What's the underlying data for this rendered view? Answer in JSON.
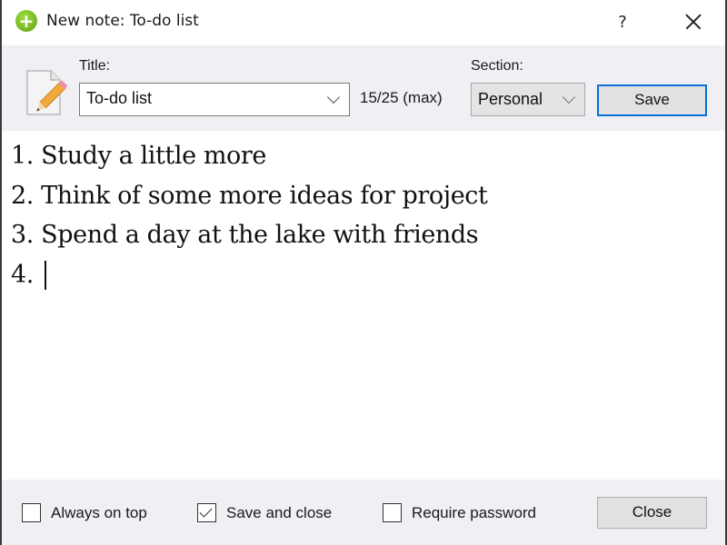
{
  "window": {
    "title": "New note: To-do list",
    "app_icon": "plus-circle-icon",
    "help_label": "?",
    "close_icon": "close-icon"
  },
  "header": {
    "note_icon": "note-pencil-icon",
    "title_label": "Title:",
    "title_value": "To-do list",
    "char_count": "15/25 (max)",
    "section_label": "Section:",
    "section_value": "Personal",
    "save_label": "Save"
  },
  "editor": {
    "lines": [
      "1. Study a little more",
      "2. Think of some more ideas for project",
      "3. Spend a day at the lake with friends",
      "4. "
    ]
  },
  "footer": {
    "always_on_top": {
      "label": "Always on top",
      "checked": false
    },
    "save_and_close": {
      "label": "Save and close",
      "checked": true
    },
    "require_password": {
      "label": "Require password",
      "checked": false
    },
    "close_label": "Close"
  },
  "colors": {
    "accent": "#0a6fd8",
    "panel_bg": "#f0f0f4",
    "app_icon_green": "#6cb520"
  }
}
